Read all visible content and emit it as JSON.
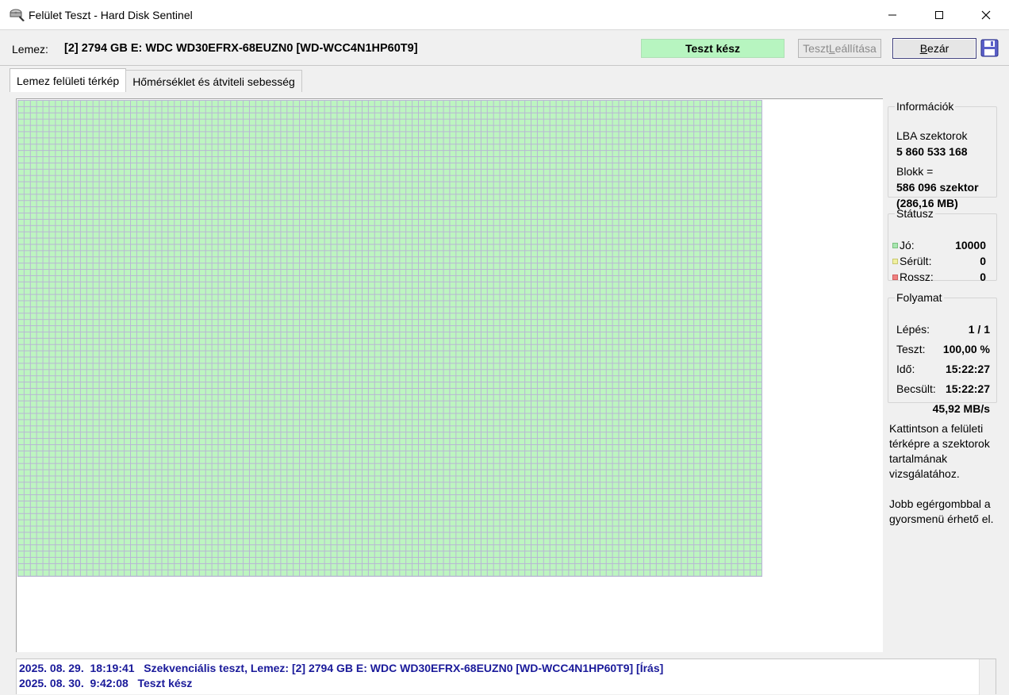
{
  "window": {
    "title": "Felület Teszt - Hard Disk Sentinel",
    "minimize": "—",
    "maximize": "☐",
    "close": "✕"
  },
  "toolbar": {
    "disk_label": "Lemez:",
    "disk_value": "[2] 2794 GB E: WDC WD30EFRX-68EUZN0 [WD-WCC4N1HP60T9]",
    "status": "Teszt kész",
    "stop_button": "Teszt Leállítása",
    "close_button": "Bezár"
  },
  "tabs": [
    {
      "label": "Lemez felületi térkép",
      "active": true
    },
    {
      "label": "Hőmérséklet és átviteli sebesség",
      "active": false
    }
  ],
  "surface_map": {
    "status": "good",
    "color": "#bdf5c0",
    "grid_color": "#b8b6d4"
  },
  "info": {
    "legend": "Információk",
    "lba_label": "LBA szektorok",
    "lba_value": "5 860 533 168",
    "block_label": "Blokk =",
    "block_value": "586 096 szektor",
    "block_size": "(286,16 MB)"
  },
  "status": {
    "legend": "Státusz",
    "good_label": "Jó:",
    "good_value": "10000",
    "good_color": "#a8e6b0",
    "damaged_label": "Sérült:",
    "damaged_value": "0",
    "damaged_color": "#f0f0a0",
    "bad_label": "Rossz:",
    "bad_value": "0",
    "bad_color": "#f08080"
  },
  "progress": {
    "legend": "Folyamat",
    "step_label": "Lépés:",
    "step_value": "1 / 1",
    "test_label": "Teszt:",
    "test_value": "100,00 %",
    "time_label": "Idő:",
    "time_value": "15:22:27",
    "estimated_label": "Becsült:",
    "estimated_value": "15:22:27",
    "speed": "45,92 MB/s"
  },
  "help": {
    "line1": "Kattintson a felületi térképre a szektorok tartalmának vizsgálatához.",
    "line2": "Jobb egérgombbal a gyorsmenü érhető el."
  },
  "log": [
    "2025. 08. 29.  18:19:41   Szekvenciális teszt, Lemez: [2] 2794 GB E: WDC WD30EFRX-68EUZN0 [WD-WCC4N1HP60T9] [Írás]",
    "2025. 08. 30.  9:42:08   Teszt kész"
  ],
  "icons": {
    "app": "hard-disk-icon",
    "save": "floppy-disk-icon"
  }
}
